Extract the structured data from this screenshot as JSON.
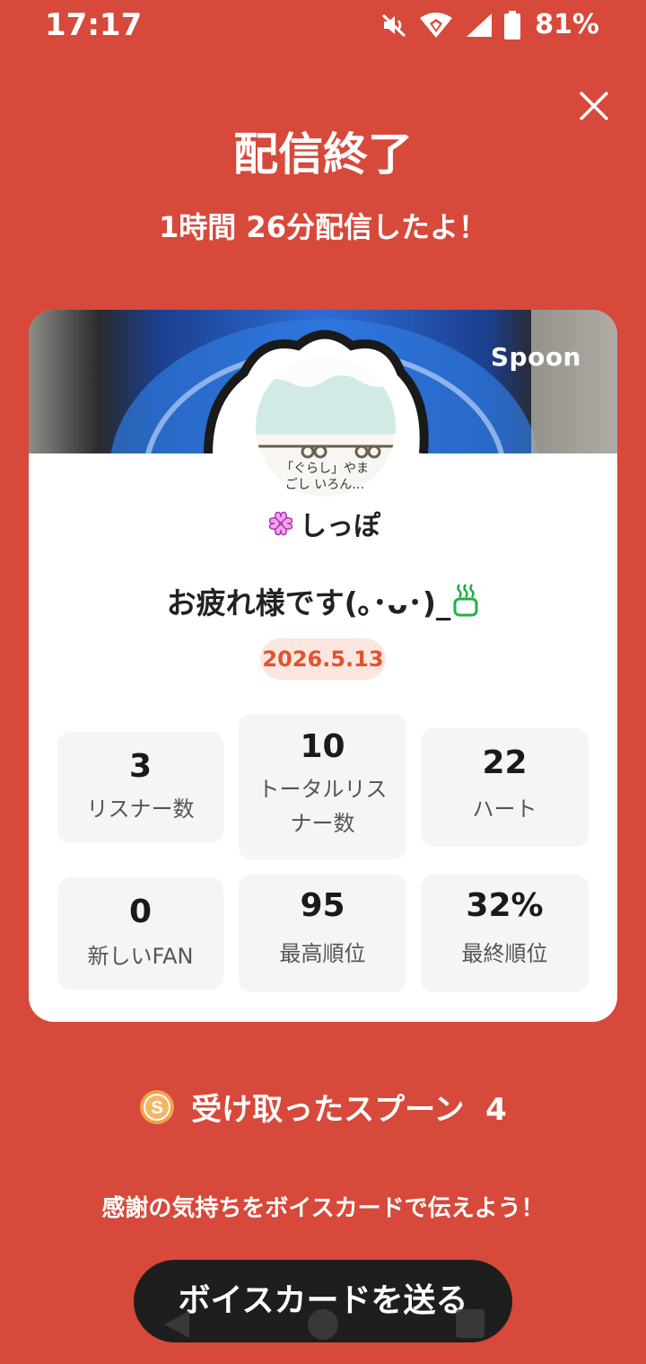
{
  "status_bar": {
    "time": "17:17",
    "battery": "81%"
  },
  "header": {
    "title": "配信終了",
    "subtitle": "1時間 26分配信したよ！"
  },
  "card": {
    "brand": "Spoon",
    "avatar_caption_line1": "「ぐらし」やま",
    "avatar_caption_line2": "ごし いろん…",
    "nickname": "しっぽ",
    "live_title": "お疲れ様です(｡･ᴗ･)_",
    "date": "2026.5.13",
    "stats": [
      {
        "value": "3",
        "label": "リスナー数"
      },
      {
        "value": "10",
        "label_line1": "トータルリス",
        "label_line2": "ナー数"
      },
      {
        "value": "22",
        "label": "ハート"
      },
      {
        "value": "0",
        "label": "新しいFAN"
      },
      {
        "value": "95",
        "label": "最高順位"
      },
      {
        "value": "32%",
        "label": "最終順位"
      }
    ]
  },
  "spoons": {
    "label": "受け取ったスプーン",
    "count": "4"
  },
  "thanks_text": "感謝の気持ちをボイスカードで伝えよう！",
  "voice_card_button": "ボイスカードを送る",
  "colors": {
    "background": "#D7493A",
    "card": "#FFFFFF",
    "date_badge_bg": "#FCE6E0",
    "date_badge_text": "#E2522D",
    "button": "#1E1E1E"
  }
}
